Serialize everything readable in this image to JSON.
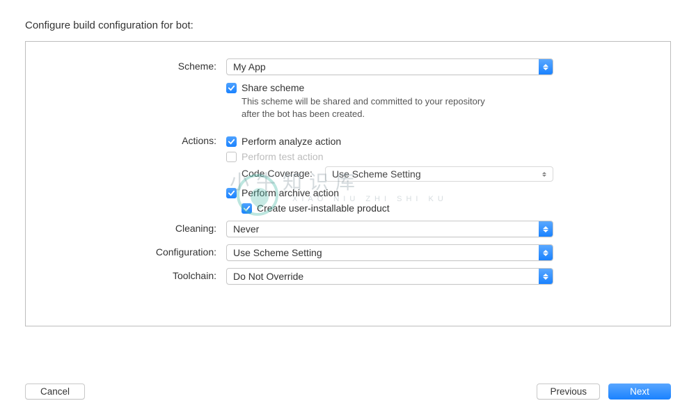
{
  "title": "Configure build configuration for bot:",
  "labels": {
    "scheme": "Scheme:",
    "actions": "Actions:",
    "cleaning": "Cleaning:",
    "configuration": "Configuration:",
    "toolchain": "Toolchain:",
    "code_coverage": "Code Coverage:"
  },
  "scheme": {
    "value": "My App",
    "share_label": "Share scheme",
    "share_checked": true,
    "share_help": "This scheme will be shared and committed to your repository after the bot has been created."
  },
  "actions": {
    "analyze": {
      "label": "Perform analyze action",
      "checked": true
    },
    "test": {
      "label": "Perform test action",
      "checked": false,
      "disabled": true
    },
    "code_coverage_value": "Use Scheme Setting",
    "archive": {
      "label": "Perform archive action",
      "checked": true
    },
    "create_installable": {
      "label": "Create user-installable product",
      "checked": true
    }
  },
  "cleaning": {
    "value": "Never"
  },
  "configuration": {
    "value": "Use Scheme Setting"
  },
  "toolchain": {
    "value": "Do Not Override"
  },
  "buttons": {
    "cancel": "Cancel",
    "previous": "Previous",
    "next": "Next"
  },
  "watermark": {
    "main": "小牛知识库",
    "sub": "XIAO NIU ZHI SHI KU"
  }
}
